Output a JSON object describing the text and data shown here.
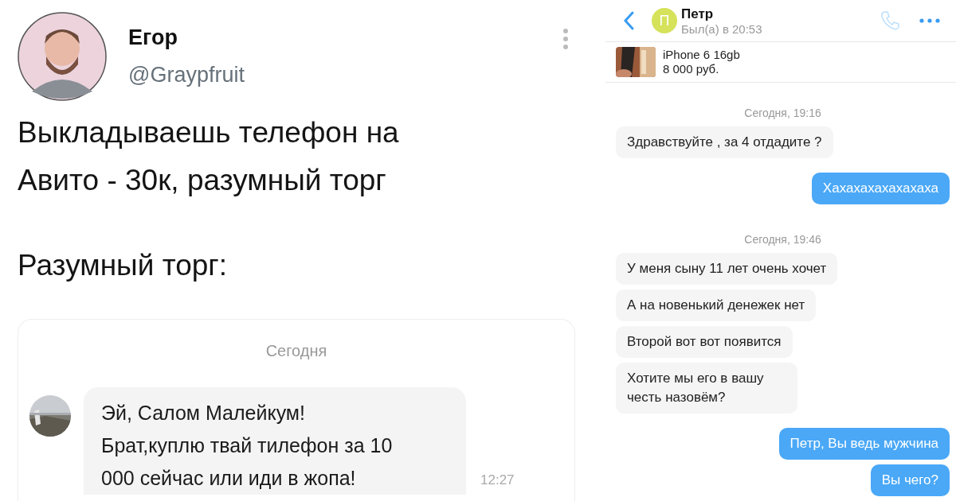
{
  "tweet": {
    "author": "Егор",
    "handle": "@Graypfruit",
    "text_lines": [
      "Выкладываешь телефон на",
      "Авито - 30к, разумный торг"
    ],
    "caption": "Разумный торг:",
    "card": {
      "date": "Сегодня",
      "message_lines": [
        "Эй, Салом Малейкум!",
        "Брат,куплю твай тилефон за 10",
        "000 сейчас или иди в жопа!"
      ],
      "time": "12:27"
    }
  },
  "chat": {
    "contact": {
      "initial": "П",
      "name": "Петр",
      "status": "Был(а) в 20:53"
    },
    "listing": {
      "title": "iPhone 6 16gb",
      "price": "8 000 руб."
    },
    "messages": [
      {
        "kind": "date",
        "text": "Сегодня, 19:16"
      },
      {
        "kind": "incoming",
        "text": "Здравствуйте , за 4 отдадите ?"
      },
      {
        "kind": "outgoing",
        "text": "Хахахахахахахаха"
      },
      {
        "kind": "date",
        "text": "Сегодня, 19:46"
      },
      {
        "kind": "incoming",
        "text": "У меня сыну 11 лет очень хочет"
      },
      {
        "kind": "incoming",
        "text": "А на новенький денежек нет"
      },
      {
        "kind": "incoming",
        "text": "Второй вот вот появится"
      },
      {
        "kind": "incoming",
        "text": "Хотите мы его в вашу честь назовём?"
      },
      {
        "kind": "outgoing",
        "text": "Петр, Вы ведь мужчина"
      },
      {
        "kind": "outgoing",
        "text": "Вы чего?"
      }
    ]
  }
}
